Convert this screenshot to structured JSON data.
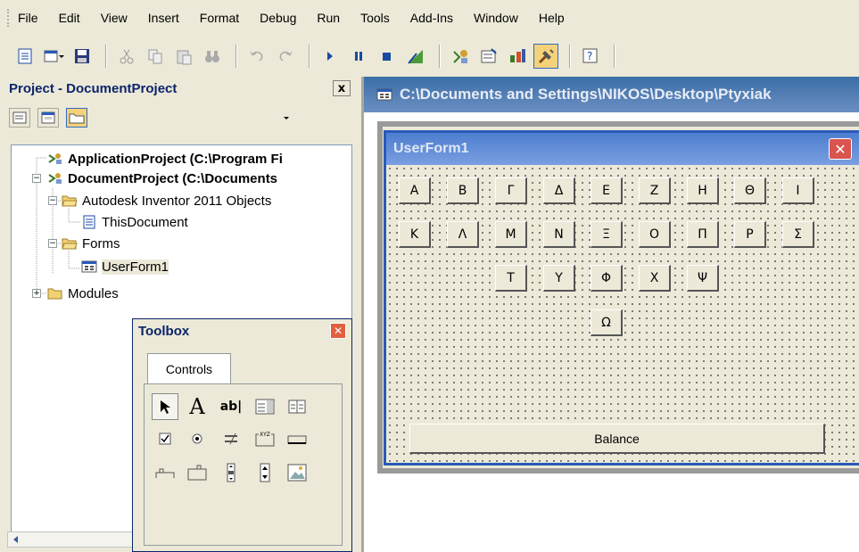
{
  "menu": [
    "File",
    "Edit",
    "View",
    "Insert",
    "Format",
    "Debug",
    "Run",
    "Tools",
    "Add-Ins",
    "Window",
    "Help"
  ],
  "project_panel": {
    "title": "Project - DocumentProject",
    "close": "x",
    "tree": [
      {
        "label": "ApplicationProject (C:\\Program Fi",
        "bold": true
      },
      {
        "label": "DocumentProject (C:\\Documents",
        "bold": true
      },
      {
        "label": "Autodesk Inventor 2011 Objects",
        "bold": false
      },
      {
        "label": "ThisDocument",
        "bold": false
      },
      {
        "label": "Forms",
        "bold": false
      },
      {
        "label": "UserForm1",
        "bold": false
      },
      {
        "label": "Modules",
        "bold": false
      }
    ]
  },
  "toolbox": {
    "title": "Toolbox",
    "tab": "Controls",
    "controls": [
      "pointer-tool",
      "label-tool",
      "textbox-tool",
      "combobox-tool",
      "listbox-tool",
      "checkbox-tool",
      "optionbutton-tool",
      "togglebutton-tool",
      "frame-tool",
      "commandbutton-tool",
      "tabstrip-tool",
      "multipage-tool",
      "scrollbar-tool",
      "spinbutton-tool",
      "image-tool"
    ],
    "label_glyph": "A",
    "textbox_glyph": "ab|",
    "frame_glyph": "XYZ"
  },
  "document_window": {
    "title": "C:\\Documents and Settings\\NIKOS\\Desktop\\Ptyxiak"
  },
  "userform": {
    "title": "UserForm1",
    "close": "✕",
    "rows": [
      [
        "Α",
        "Β",
        "Γ",
        "Δ",
        "Ε",
        "Ζ",
        "Η",
        "Θ",
        "Ι"
      ],
      [
        "Κ",
        "Λ",
        "Μ",
        "Ν",
        "Ξ",
        "Ο",
        "Π",
        "Ρ",
        "Σ"
      ],
      [
        "Τ",
        "Υ",
        "Φ",
        "Χ",
        "Ψ"
      ],
      [
        "Ω"
      ]
    ],
    "balance": "Balance"
  }
}
